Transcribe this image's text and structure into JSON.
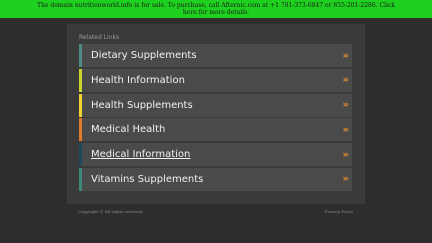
{
  "banner": {
    "text": "The domain nutritionworld.info is for sale. To purchase, call Afternic.com at +1 781-373-6847 or 855-201-2286. Click here for more details."
  },
  "related_links": {
    "heading": "Related Links",
    "items": [
      {
        "label": "Dietary Supplements",
        "accent": "#4e8a86",
        "arrow": "»"
      },
      {
        "label": "Health Information",
        "accent": "#c9d62e",
        "arrow": "»"
      },
      {
        "label": "Health Supplements",
        "accent": "#f1d230",
        "arrow": "»"
      },
      {
        "label": "Medical Health",
        "accent": "#e07a2a",
        "arrow": "»"
      },
      {
        "label": "Medical Information",
        "accent": "#1f4a5a",
        "arrow": "»"
      },
      {
        "label": "Vitamins Supplements",
        "accent": "#3d8a7a",
        "arrow": "»"
      }
    ]
  },
  "footer": {
    "copyright": "Copyright ©  All rights reserved.",
    "privacy": "Privacy Policy"
  },
  "colors": {
    "banner_bg": "#1fd11f",
    "page_bg": "#2d2d2d",
    "panel_bg": "#3a3a3a",
    "item_bg": "#4a4a4a",
    "arrow": "#e08a2e"
  }
}
